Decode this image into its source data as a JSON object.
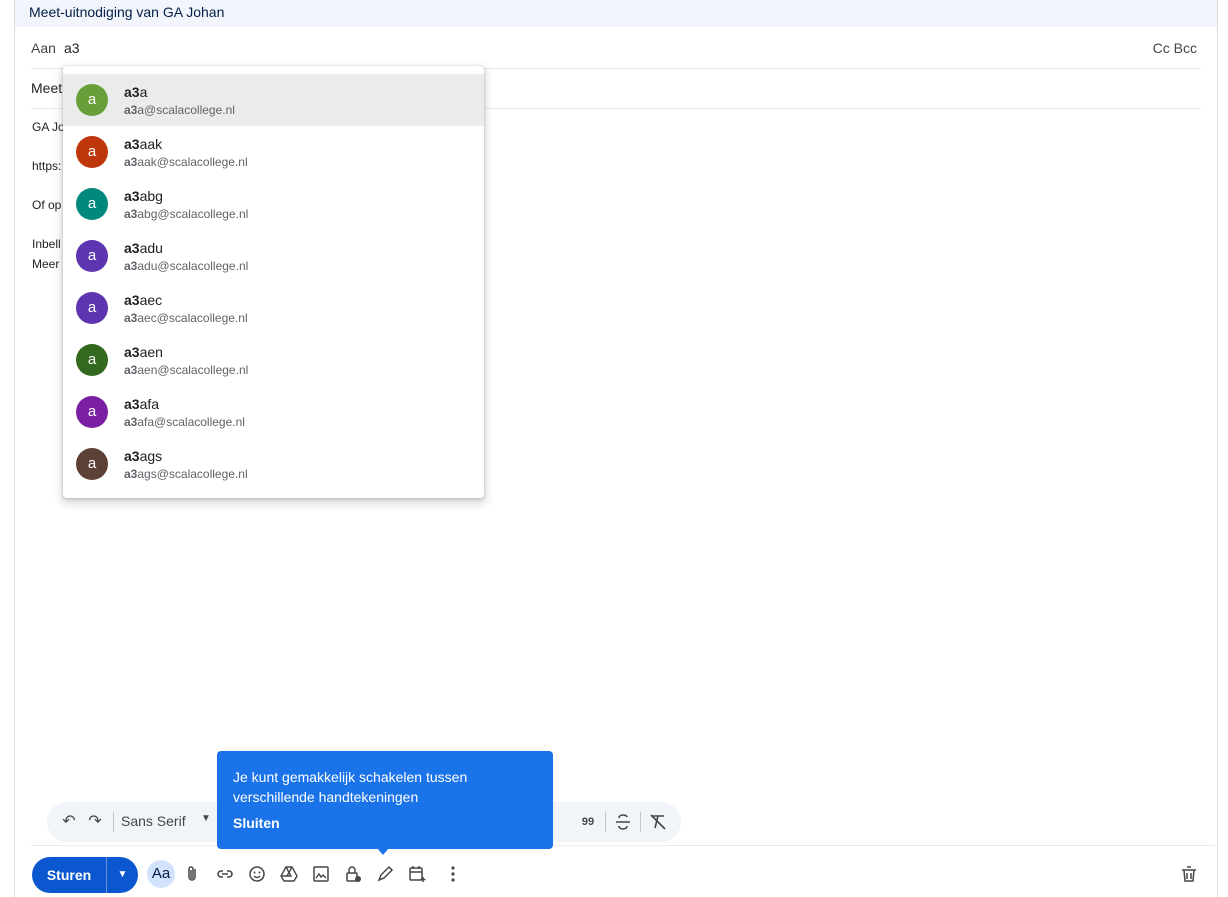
{
  "window": {
    "title": "Meet-uitnodiging van GA Johan"
  },
  "to": {
    "label": "Aan",
    "value": "a3",
    "cc_bcc": "Cc Bcc"
  },
  "subject": {
    "visible_text": "Meet"
  },
  "body": {
    "lines": [
      "GA Jo",
      "https:",
      "Of op",
      "Inbell",
      "Meer"
    ]
  },
  "suggestions": [
    {
      "initial": "a",
      "name_bold": "a3",
      "name_rest": "a",
      "email_bold": "a3",
      "email_rest": "a@scalacollege.nl",
      "color": "#689f38"
    },
    {
      "initial": "a",
      "name_bold": "a3",
      "name_rest": "aak",
      "email_bold": "a3",
      "email_rest": "aak@scalacollege.nl",
      "color": "#bf360c"
    },
    {
      "initial": "a",
      "name_bold": "a3",
      "name_rest": "abg",
      "email_bold": "a3",
      "email_rest": "abg@scalacollege.nl",
      "color": "#00897b"
    },
    {
      "initial": "a",
      "name_bold": "a3",
      "name_rest": "adu",
      "email_bold": "a3",
      "email_rest": "adu@scalacollege.nl",
      "color": "#5e35b1"
    },
    {
      "initial": "a",
      "name_bold": "a3",
      "name_rest": "aec",
      "email_bold": "a3",
      "email_rest": "aec@scalacollege.nl",
      "color": "#5e35b1"
    },
    {
      "initial": "a",
      "name_bold": "a3",
      "name_rest": "aen",
      "email_bold": "a3",
      "email_rest": "aen@scalacollege.nl",
      "color": "#33691e"
    },
    {
      "initial": "a",
      "name_bold": "a3",
      "name_rest": "afa",
      "email_bold": "a3",
      "email_rest": "afa@scalacollege.nl",
      "color": "#7b1fa2"
    },
    {
      "initial": "a",
      "name_bold": "a3",
      "name_rest": "ags",
      "email_bold": "a3",
      "email_rest": "ags@scalacollege.nl",
      "color": "#5d4037"
    }
  ],
  "format_toolbar": {
    "font": "Sans Serif",
    "quote_glyph": "99"
  },
  "tooltip": {
    "text": "Je kunt gemakkelijk schakelen tussen verschillende handtekeningen",
    "close_label": "Sluiten"
  },
  "bottom_toolbar": {
    "send_label": "Sturen",
    "text_format_label": "Aa",
    "icons": [
      "attach-icon",
      "link-icon",
      "emoji-icon",
      "drive-icon",
      "image-icon",
      "confidential-icon",
      "signature-icon",
      "schedule-icon",
      "more-icon",
      "trash-icon"
    ]
  }
}
